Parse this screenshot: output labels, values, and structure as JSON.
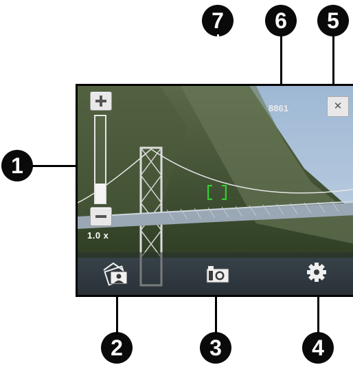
{
  "callouts": [
    "1",
    "2",
    "3",
    "4",
    "5",
    "6",
    "7"
  ],
  "viewfinder": {
    "zoom": {
      "plus_icon": "plus-icon",
      "minus_icon": "minus-icon",
      "level_text": "1.0 x",
      "level_fraction": 0.22
    },
    "shot_count": "8861",
    "close_icon": "close-icon",
    "close_glyph": "✕",
    "focus_frame": "focus-bracket-icon",
    "bottom_bar": {
      "album_icon": "photo-album-icon",
      "capture_icon": "camera-icon",
      "settings_icon": "gear-icon"
    }
  },
  "colors": {
    "focus": "#33cc33",
    "callout_bg": "#0a0a0a",
    "bar_bg": "rgba(40,45,45,0.55)"
  }
}
